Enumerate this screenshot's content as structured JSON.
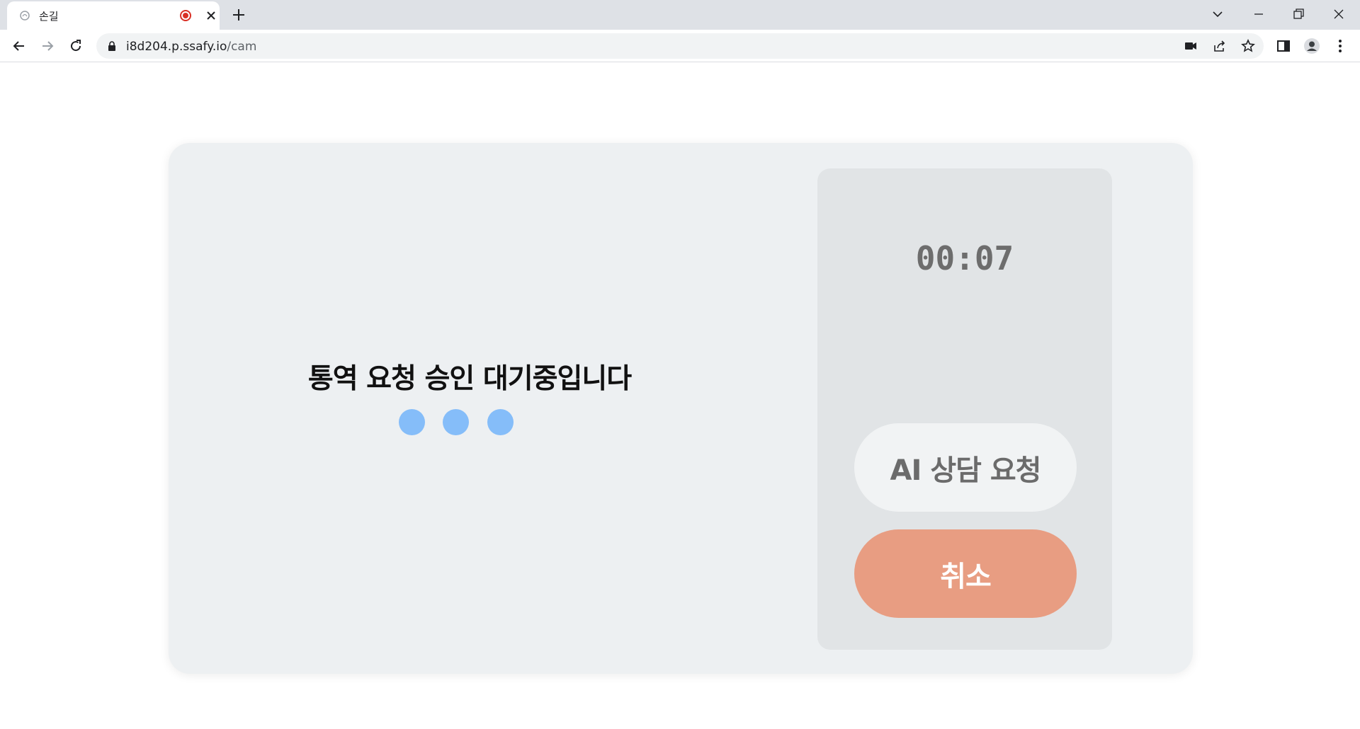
{
  "browser": {
    "tab_title": "손길",
    "url_host": "i8d204.p.ssafy.io",
    "url_path": "/cam"
  },
  "page": {
    "waiting_message": "통역 요청 승인 대기중입니다",
    "timer": "00:07",
    "ai_button_label": "AI 상담 요청",
    "cancel_button_label": "취소"
  },
  "colors": {
    "card_bg": "#edf0f2",
    "panel_bg": "#e1e4e6",
    "dot": "#85bdf9",
    "cancel_button": "#e89d82",
    "recording": "#d93025"
  }
}
